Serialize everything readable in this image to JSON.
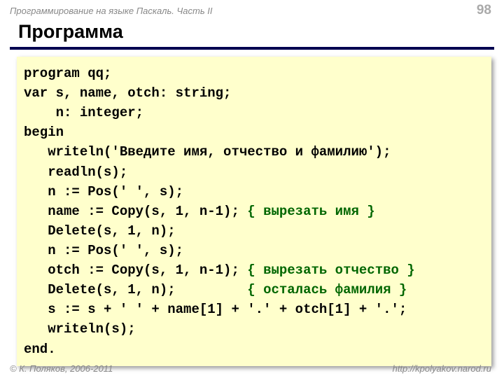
{
  "header": {
    "course": "Программирование на языке Паскаль. Часть II",
    "page": "98"
  },
  "title": "Программа",
  "code": {
    "lines": [
      {
        "text": "program qq;",
        "indent": 0
      },
      {
        "text": "var s, name, otch: string;",
        "indent": 0
      },
      {
        "text": "n: integer;",
        "indent": 2
      },
      {
        "text": "begin",
        "indent": 0
      },
      {
        "text": "writeln('Введите имя, отчество и фамилию');",
        "indent": 1
      },
      {
        "text": "readln(s);",
        "indent": 1
      },
      {
        "text": "n := Pos(' ', s);",
        "indent": 1
      },
      {
        "text": "name := Copy(s, 1, n-1);",
        "indent": 1,
        "comment": "{ вырезать имя }",
        "comment_col": 28
      },
      {
        "text": "Delete(s, 1, n);",
        "indent": 1
      },
      {
        "text": "n := Pos(' ', s);",
        "indent": 1
      },
      {
        "text": "otch := Copy(s, 1, n-1);",
        "indent": 1,
        "comment": "{ вырезать отчество }",
        "comment_col": 28
      },
      {
        "text": "Delete(s, 1, n);",
        "indent": 1,
        "comment": "{ осталась фамилия }",
        "comment_col": 28
      },
      {
        "text": "s := s + ' ' + name[1] + '.' + otch[1] + '.';",
        "indent": 1
      },
      {
        "text": "writeln(s);",
        "indent": 1
      },
      {
        "text": "end.",
        "indent": 0
      }
    ]
  },
  "footer": {
    "copyright": "© К. Поляков, 2006-2011",
    "url": "http://kpolyakov.narod.ru"
  }
}
